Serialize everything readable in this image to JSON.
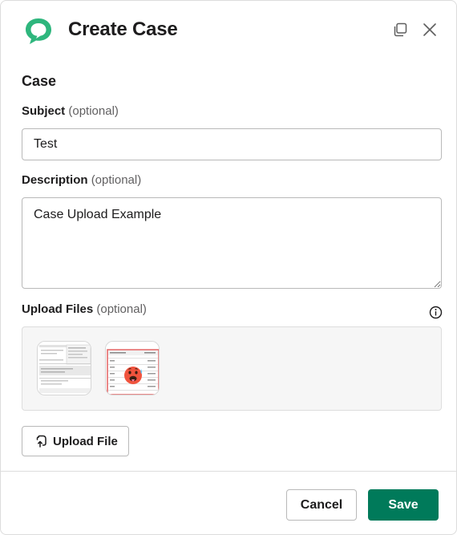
{
  "header": {
    "title": "Create Case",
    "logo_icon": "speech-bubble-logo-icon",
    "logo_color": "#2eb67d",
    "expand_icon": "expand-window-icon",
    "close_icon": "close-icon"
  },
  "section": {
    "title": "Case"
  },
  "subject": {
    "label": "Subject",
    "optional": "(optional)",
    "value": "Test"
  },
  "description": {
    "label": "Description",
    "optional": "(optional)",
    "value": "Case Upload Example"
  },
  "upload": {
    "label": "Upload Files",
    "optional": "(optional)",
    "info_icon": "info-icon",
    "thumbnails": [
      {
        "name": "screenshot-thumbnail",
        "kind": "table-screenshot"
      },
      {
        "name": "emoji-screenshot-thumbnail",
        "kind": "table-with-emoji",
        "emoji": "🥵"
      }
    ],
    "button_label": "Upload File",
    "button_icon": "upload-file-icon"
  },
  "footer": {
    "cancel_label": "Cancel",
    "save_label": "Save",
    "save_color": "#007a5a"
  }
}
